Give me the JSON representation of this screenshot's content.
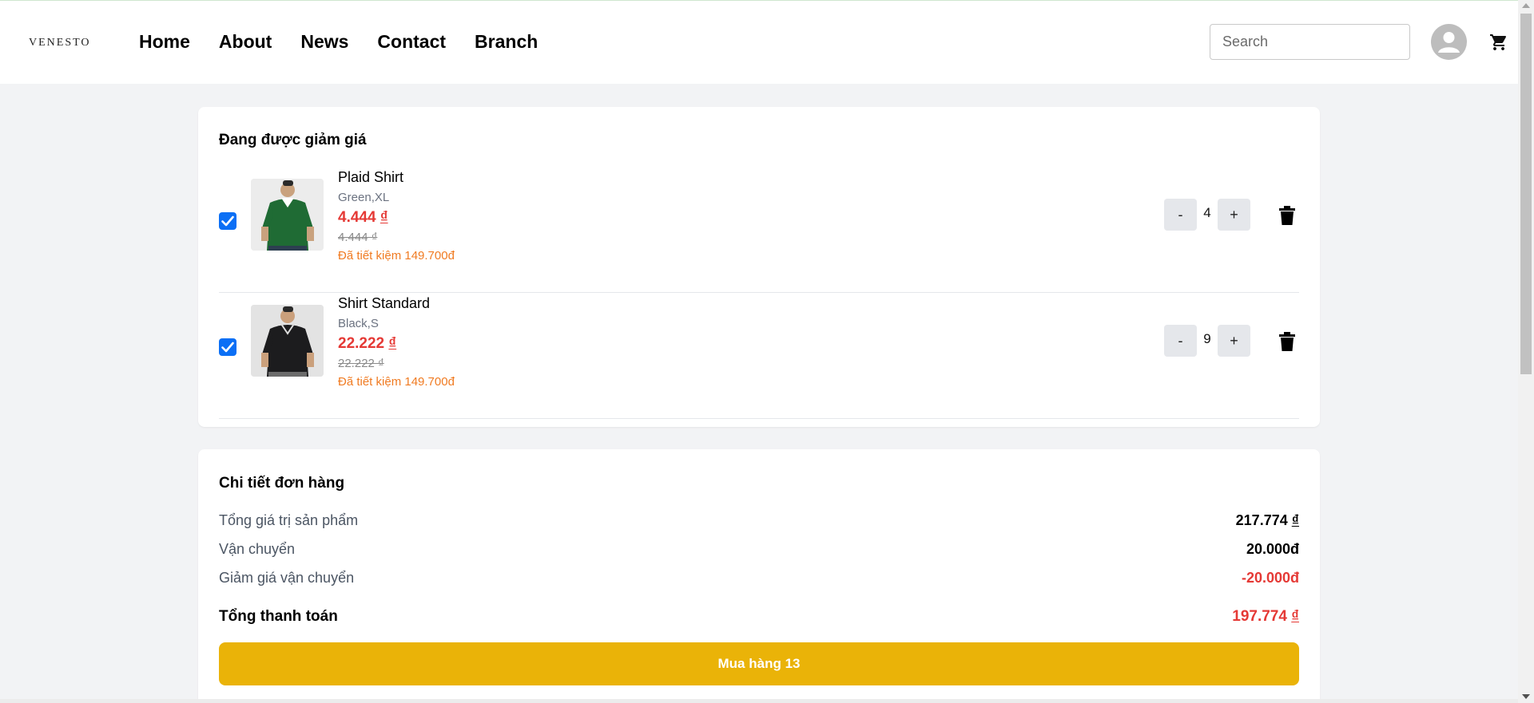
{
  "header": {
    "logo": "VENESTO",
    "nav": [
      "Home",
      "About",
      "News",
      "Contact",
      "Branch"
    ],
    "search_placeholder": "Search",
    "icons": {
      "avatar": "user-avatar-icon",
      "cart": "shopping-cart-icon"
    }
  },
  "cart": {
    "title": "Đang được giảm giá",
    "items": [
      {
        "name": "Plaid Shirt",
        "variant": "Green,XL",
        "price": "4.444",
        "currency": "₫",
        "old_price": "4.444 ₫",
        "saved": "Đã tiết kiệm 149.700đ",
        "quantity": "4",
        "checked": true,
        "shirt_color": "#1f6b34"
      },
      {
        "name": "Shirt Standard",
        "variant": "Black,S",
        "price": "22.222",
        "currency": "₫",
        "old_price": "22.222 ₫",
        "saved": "Đã tiết kiệm 149.700đ",
        "quantity": "9",
        "checked": true,
        "shirt_color": "#1c1c1e"
      }
    ],
    "minus_label": "-",
    "plus_label": "+"
  },
  "summary": {
    "title": "Chi tiết đơn hàng",
    "rows": [
      {
        "label": "Tổng giá trị sản phẩm",
        "value": "217.774",
        "currency": "₫"
      },
      {
        "label": "Vận chuyển",
        "value": "20.000đ"
      },
      {
        "label": "Giảm giá vận chuyển",
        "value": "-20.000đ"
      }
    ],
    "total_label": "Tổng thanh toán",
    "total_value": "197.774",
    "total_currency": "₫",
    "buy_button": "Mua hàng 13"
  },
  "colors": {
    "accent": "#eab308",
    "price_red": "#e53935",
    "saving_orange": "#f07b22",
    "checkbox_blue": "#0b6ff5"
  }
}
